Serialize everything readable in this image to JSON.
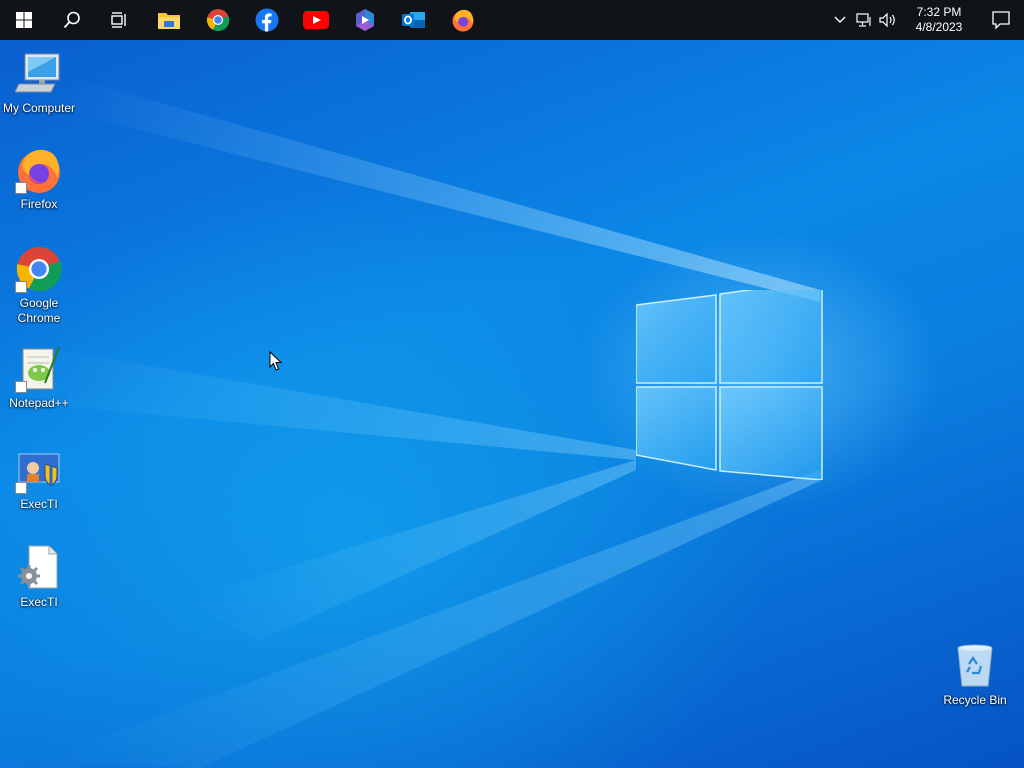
{
  "taskbar": {
    "pinned": [
      {
        "name": "file-explorer"
      },
      {
        "name": "google-chrome"
      },
      {
        "name": "facebook"
      },
      {
        "name": "youtube"
      },
      {
        "name": "microsoft-365"
      },
      {
        "name": "outlook"
      },
      {
        "name": "firefox"
      }
    ],
    "clock": {
      "time": "7:32 PM",
      "date": "4/8/2023"
    }
  },
  "desktop": {
    "icons": [
      {
        "label": "My Computer",
        "icon": "computer-icon"
      },
      {
        "label": "Firefox",
        "icon": "firefox-icon"
      },
      {
        "label": "Google Chrome",
        "icon": "chrome-icon"
      },
      {
        "label": "Notepad++",
        "icon": "notepadpp-icon"
      },
      {
        "label": "ExecTI",
        "icon": "execti-shield-icon"
      },
      {
        "label": "ExecTI",
        "icon": "execti-gear-file-icon"
      },
      {
        "label": "Recycle Bin",
        "icon": "recycle-bin-icon"
      }
    ]
  },
  "colors": {
    "taskbar": "#101418",
    "wallpaper": "#0a7fe0",
    "accent": "#0078d7"
  }
}
